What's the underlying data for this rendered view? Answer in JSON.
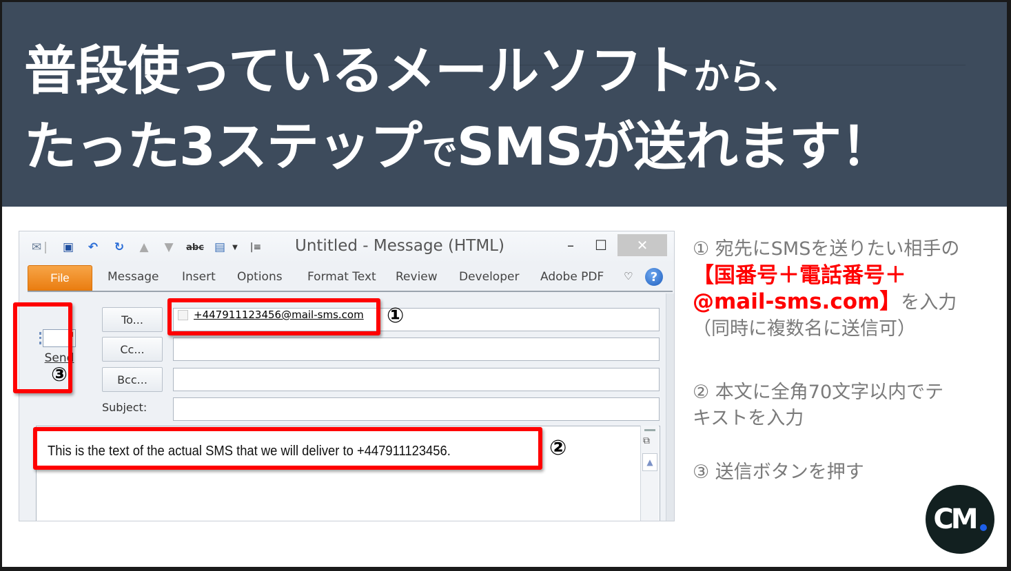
{
  "header": {
    "line1_main": "普段使っているメールソフト",
    "line1_small": "から、",
    "line2_a": "たった3ステップ",
    "line2_small": "で",
    "line2_b": "SMSが送れます！"
  },
  "outlook": {
    "window_title": "Untitled  -  Message (HTML)",
    "quick_access_icons": [
      "send-receive-icon",
      "save-icon",
      "undo-icon",
      "redo-icon",
      "previous-item-icon",
      "next-item-icon",
      "spelling-icon",
      "format-icon",
      "dropdown-icon",
      "customize-qat-icon"
    ],
    "window_controls": {
      "minimize": "–",
      "maximize": "☐",
      "close": "✕"
    },
    "tabs": [
      {
        "label": "File"
      },
      {
        "label": "Message"
      },
      {
        "label": "Insert"
      },
      {
        "label": "Options"
      },
      {
        "label": "Format Text"
      },
      {
        "label": "Review"
      },
      {
        "label": "Developer"
      },
      {
        "label": "Adobe PDF"
      }
    ],
    "help_icon": "?",
    "send_label": "Send",
    "to_label": "To...",
    "cc_label": "Cc...",
    "bcc_label": "Bcc...",
    "subject_label": "Subject:",
    "to_value": "+447911123456@mail-sms.com",
    "cc_value": "",
    "bcc_value": "",
    "subject_value": "",
    "body_text": "This is the text of the actual SMS that we will deliver to +447911123456."
  },
  "markers": {
    "one": "①",
    "two": "②",
    "three": "③"
  },
  "instructions": {
    "step1_a": "① 宛先にSMSを送りたい相手の",
    "step1_red1": "【国番号＋電話番号＋",
    "step1_red2": "@mail-sms.com】",
    "step1_b": "を入力",
    "step1_c": "（同時に複数名に送信可）",
    "step2_a": "② 本文に全角70文字以内でテ",
    "step2_b": "キストを入力",
    "step3": "③ 送信ボタンを押す"
  },
  "logo": {
    "text": "CM"
  },
  "colors": {
    "header_bg": "#3d4b5c",
    "highlight_red": "#ff0000",
    "file_tab": "#ea7d11",
    "instruction_gray": "#7a7a7a",
    "logo_bg": "#122020",
    "logo_dot": "#1d5fe8"
  }
}
